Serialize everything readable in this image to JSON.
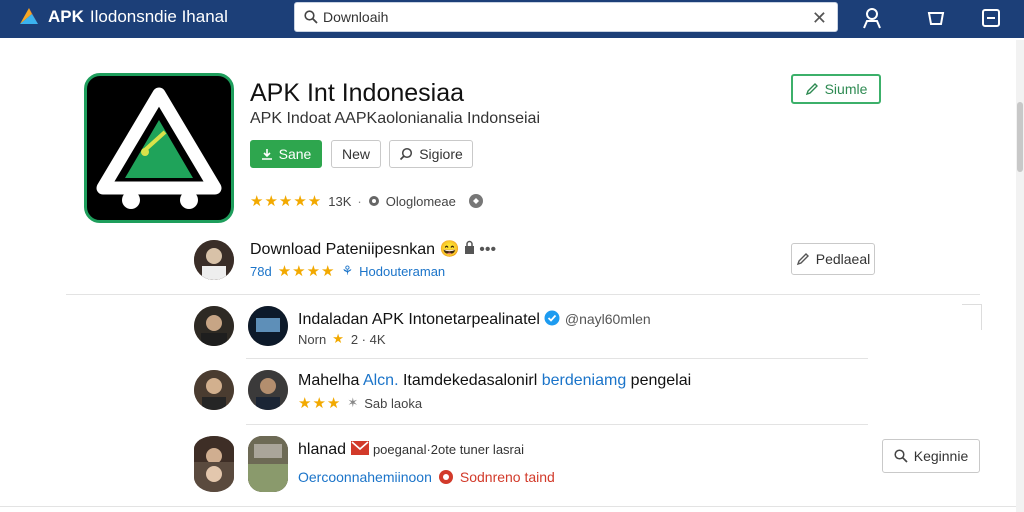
{
  "header": {
    "brand_bold": "APK",
    "brand_rest": "Ilodonsndie Ihanal",
    "search_placeholder": "Downloaih",
    "icons": [
      "logo-icon",
      "user-icon",
      "cart-icon",
      "menu-icon"
    ]
  },
  "app": {
    "title": "APK Int Indonesiaa",
    "subtitle": "APK Indoat AAPKaolonianalia Indonseiai",
    "buttons": {
      "install": "Sane",
      "new": "New",
      "explore": "Sigiore",
      "share": "Siumle"
    },
    "rating_stars": "★★★★★",
    "downloads": "13K",
    "developer": "Ologlomeae"
  },
  "featured": {
    "title": "Download Pateniipesnkan",
    "count": "78d",
    "stars": "★★★★",
    "category": "Hodouteraman",
    "button": "Pedlaeal"
  },
  "rows": [
    {
      "title": "Indaladan APK Intonetarpealinatel",
      "handle": "@nayl60mlen",
      "meta_a": "Norn",
      "meta_b": "2 · 4K"
    },
    {
      "title_a": "Mahelha",
      "title_blue": "Alcn.",
      "title_b": "Itamdekedasalonirl",
      "title_blue2": "berdeniamg",
      "title_c": "pengelai",
      "stars": "★★★",
      "meta": "Sab laoka"
    },
    {
      "title_a": "hlanad",
      "title_b": "poeganal·2ote tuner lasrai",
      "link_blue": "Oercoonnahemiinoon",
      "link_red": "Sodnreno taind",
      "button": "Keginnie"
    }
  ],
  "colors": {
    "header": "#1c3f78",
    "accent_green": "#2ea64e",
    "star": "#f2a900",
    "link_blue": "#1b74c9"
  }
}
